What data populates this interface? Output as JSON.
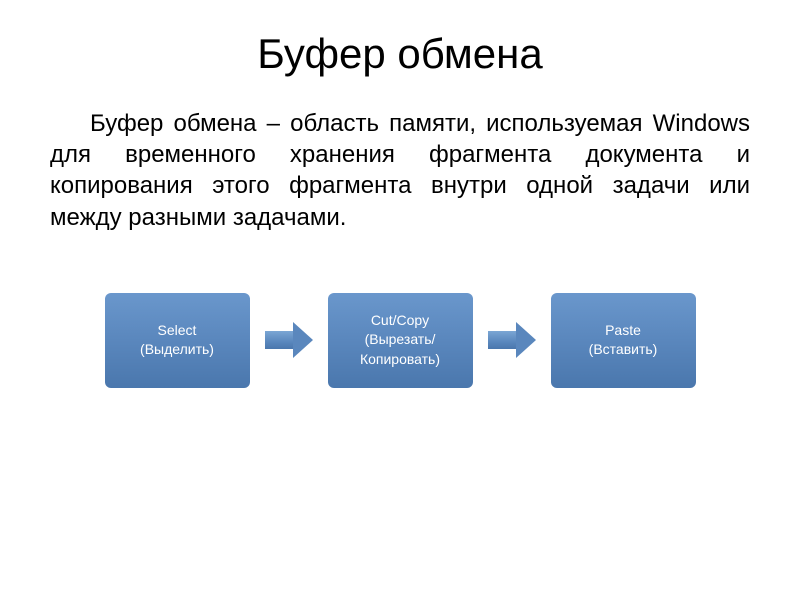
{
  "title": "Буфер обмена",
  "description": "Буфер обмена – область памяти, используемая Windows для временного хранения фрагмента документа и копирования этого фрагмента внутри одной задачи или между разными задачами.",
  "steps": [
    {
      "line1": "Select",
      "line2": "(Выделить)"
    },
    {
      "line1": "Cut/Copy",
      "line2": "(Вырезать/",
      "line3": "Копировать)"
    },
    {
      "line1": "Paste",
      "line2": "(Вставить)"
    }
  ]
}
